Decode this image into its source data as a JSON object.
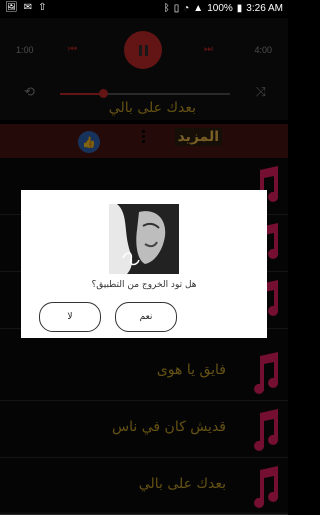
{
  "status": {
    "battery": "100%",
    "time": "3:26 AM"
  },
  "player": {
    "elapsed": "1:00",
    "duration": "4:00",
    "progress": 0.25,
    "now_playing": "بعدك على بالي"
  },
  "header": {
    "more_label": "المزيد"
  },
  "songs": [
    {
      "title": "فايق يا هوى"
    },
    {
      "title": "قديش كان في ناس"
    },
    {
      "title": "بعدك على بالي"
    }
  ],
  "dialog": {
    "message": "هل تود الخروج من التطبيق؟",
    "yes_label": "نعم",
    "no_label": "لا"
  },
  "colors": {
    "accent": "#c62828",
    "gold": "#c9a227",
    "pink": "#e91e63"
  }
}
